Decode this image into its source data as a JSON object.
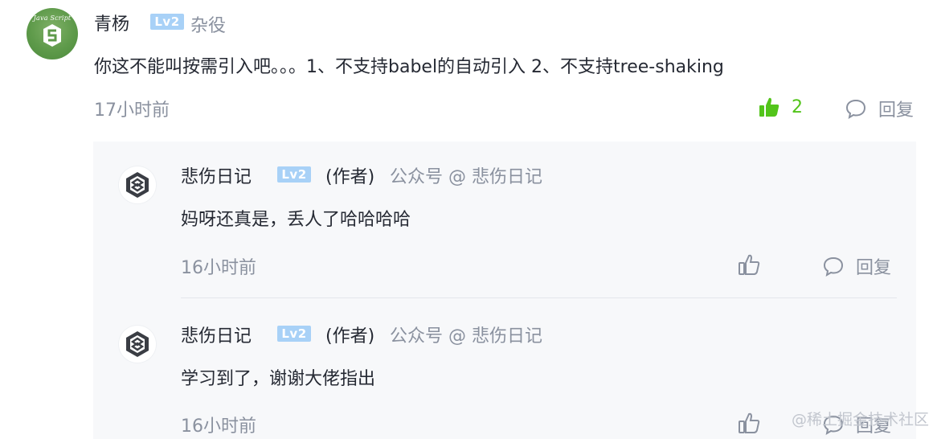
{
  "comment": {
    "avatar_text": "Java Script",
    "username": "青杨",
    "level": "Lv2",
    "title": "杂役",
    "content": "你这不能叫按需引入吧。。。1、不支持babel的自动引入 2、不支持tree-shaking",
    "time": "17小时前",
    "like_count": "2",
    "reply_label": "回复"
  },
  "replies": [
    {
      "username": "悲伤日记",
      "level": "Lv2",
      "role": "(作者)",
      "meta": "公众号 @ 悲伤日记",
      "content": "妈呀还真是，丢人了哈哈哈哈",
      "time": "16小时前",
      "reply_label": "回复"
    },
    {
      "username": "悲伤日记",
      "level": "Lv2",
      "role": "(作者)",
      "meta": "公众号 @ 悲伤日记",
      "content": "学习到了，谢谢大佬指出",
      "time": "16小时前",
      "reply_label": "回复"
    }
  ],
  "watermark": "@稀土掘金技术社区",
  "colors": {
    "accent_like": "#52c41a",
    "muted_text": "#8a919f",
    "level_badge": "#a8d1f7",
    "reply_background": "#f7f8fa"
  },
  "icons": [
    "javascript-avatar",
    "thumbs-up-icon",
    "comment-icon",
    "brand-logo-avatar"
  ]
}
